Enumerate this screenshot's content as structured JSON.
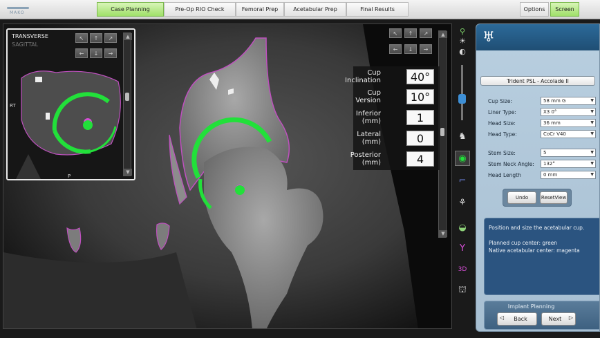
{
  "app": {
    "logo_text": "MAKO"
  },
  "tabs": [
    {
      "label": "Case Planning",
      "active": true
    },
    {
      "label": "Pre-Op RIO Check",
      "active": false
    },
    {
      "label": "Femoral Prep",
      "active": false
    },
    {
      "label": "Acetabular Prep",
      "active": false
    },
    {
      "label": "Final Results",
      "active": false
    }
  ],
  "top_right": {
    "options_label": "Options",
    "screen_label": "Screen"
  },
  "inset": {
    "view_primary": "TRANSVERSE",
    "view_secondary": "SAGITTAL",
    "side_label": "RT",
    "bottom_label": "P"
  },
  "measurements": [
    {
      "label_line1": "Cup",
      "label_line2": "Inclination",
      "value": "40°"
    },
    {
      "label_line1": "Cup",
      "label_line2": "Version",
      "value": "10°"
    },
    {
      "label_line1": "Inferior",
      "label_line2": "(mm)",
      "value": "1"
    },
    {
      "label_line1": "Lateral",
      "label_line2": "(mm)",
      "value": "0"
    },
    {
      "label_line1": "Posterior",
      "label_line2": "(mm)",
      "value": "4"
    }
  ],
  "right_panel": {
    "implant_system": "Trident PSL - Accolade II",
    "fields": [
      {
        "label": "Cup Size:",
        "value": "58 mm G"
      },
      {
        "label": "Liner Type:",
        "value": "X3 0°"
      },
      {
        "label": "Head Size:",
        "value": "36 mm"
      },
      {
        "label": "Head Type:",
        "value": "CoCr V40"
      },
      {
        "label": "Stem Size:",
        "value": "5"
      },
      {
        "label": "Stem Neck Angle:",
        "value": "132°"
      },
      {
        "label": "Head Length",
        "value": "0 mm"
      }
    ],
    "undo_label": "Undo",
    "reset_label_line1": "Reset",
    "reset_label_line2": "View",
    "info_line1": "Position and size the acetabular cup.",
    "info_line2": "Planned cup center: green",
    "info_line3": "Native acetabular center: magenta",
    "planning_title": "Implant Planning",
    "back_label": "Back",
    "next_label": "Next"
  },
  "colors": {
    "planned": "#22e03a",
    "native": "#d64fd6",
    "accent_tab": "#9fe06a"
  }
}
